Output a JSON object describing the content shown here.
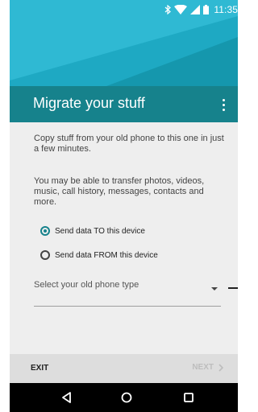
{
  "status_bar": {
    "time": "11:35",
    "icons": [
      "bluetooth-icon",
      "wifi-icon",
      "signal-icon",
      "battery-icon"
    ]
  },
  "toolbar": {
    "title": "Migrate your stuff",
    "menu_icon": "overflow-menu-icon"
  },
  "content": {
    "intro": "Copy stuff from your old phone to this one in just a few minutes.",
    "details": "You may be able to transfer photos, videos, music, call history, messages, contacts and more."
  },
  "options": [
    {
      "label": "Send data TO this device",
      "selected": true
    },
    {
      "label": "Send data FROM this device",
      "selected": false
    }
  ],
  "phone_type_select": {
    "placeholder": "Select your old phone type"
  },
  "footer": {
    "exit_label": "EXIT",
    "next_label": "NEXT",
    "next_enabled": false
  },
  "navigation": [
    "back-icon",
    "home-icon",
    "recents-icon"
  ],
  "colors": {
    "accent": "#16828c",
    "hero_light": "#35bdd6",
    "hero_dark": "#1aa6bf",
    "background": "#eeeeee"
  }
}
